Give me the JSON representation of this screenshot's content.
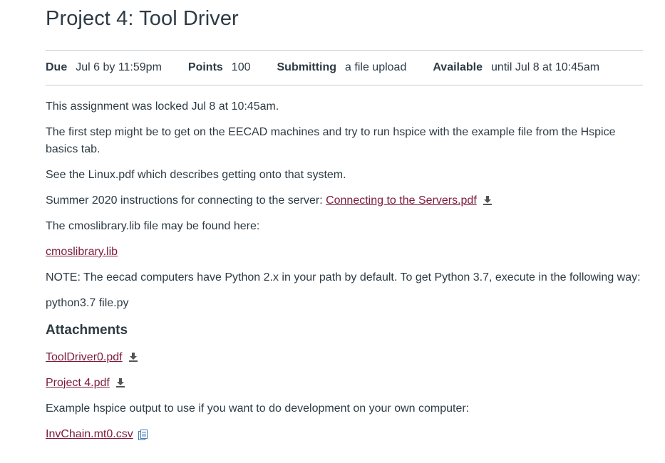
{
  "page_title": "Project 4: Tool Driver",
  "details": [
    {
      "key": "Due",
      "value": "Jul 6 by 11:59pm"
    },
    {
      "key": "Points",
      "value": "100"
    },
    {
      "key": "Submitting",
      "value": "a file upload"
    },
    {
      "key": "Available",
      "value": "until Jul 8 at 10:45am"
    }
  ],
  "description": {
    "locked_notice": "This assignment was locked Jul 8 at 10:45am.",
    "first_step": "The first step might be to get on the EECAD machines and try to run hspice with the example file from the Hspice basics tab.",
    "linux_pdf": "See the Linux.pdf which describes getting onto that system.",
    "summer_prefix": "Summer 2020 instructions for connecting to the server: ",
    "summer_link": "Connecting to the Servers.pdf",
    "cmos_text": "The cmoslibrary.lib file may be found here:",
    "cmos_link": "cmoslibrary.lib",
    "note": "NOTE: The eecad computers have Python 2.x in your path by default. To get Python 3.7, execute in the following way:",
    "python_cmd": "python3.7 file.py"
  },
  "attachments": {
    "heading": "Attachments",
    "files": [
      "ToolDriver0.pdf",
      "Project 4.pdf"
    ],
    "example_text": "Example hspice output to use if you want to do development on your own computer:",
    "example_file": "InvChain.mt0.csv"
  },
  "colors": {
    "link": "#7d1a3b",
    "text": "#2d3b45",
    "divider": "#c7cdd1"
  },
  "icons": {
    "download": "download-icon",
    "preview": "file-preview-icon"
  }
}
